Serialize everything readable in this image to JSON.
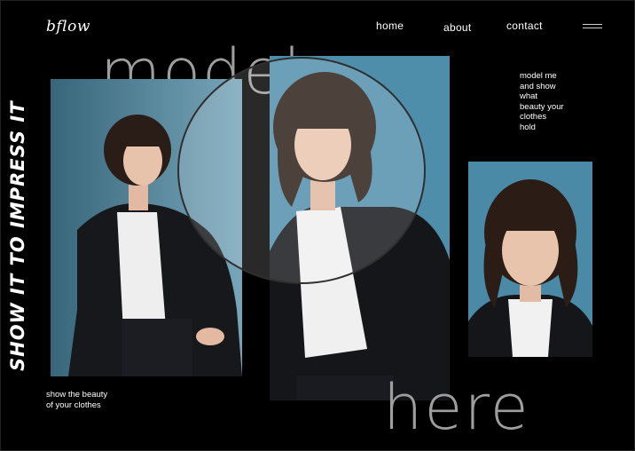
{
  "brand": {
    "logo": "bflow"
  },
  "nav": {
    "home": "home",
    "about": "about",
    "contact": "contact"
  },
  "headline_vertical": "SHOW IT TO IMPRESS IT",
  "hero": {
    "word_top": "model",
    "word_bottom": "here"
  },
  "side_text": {
    "lines": [
      "model me",
      "and show",
      "what",
      "beauty your",
      "clothes",
      "hold"
    ]
  },
  "bottom_text": {
    "lines": [
      "show the beauty",
      "of your clothes"
    ]
  },
  "colors": {
    "background": "#000000",
    "wall_blue": "#4f8eab",
    "accent_grey": "#9e9e9e",
    "text": "#ffffff"
  },
  "icons": {
    "menu": "hamburger-menu-icon"
  }
}
